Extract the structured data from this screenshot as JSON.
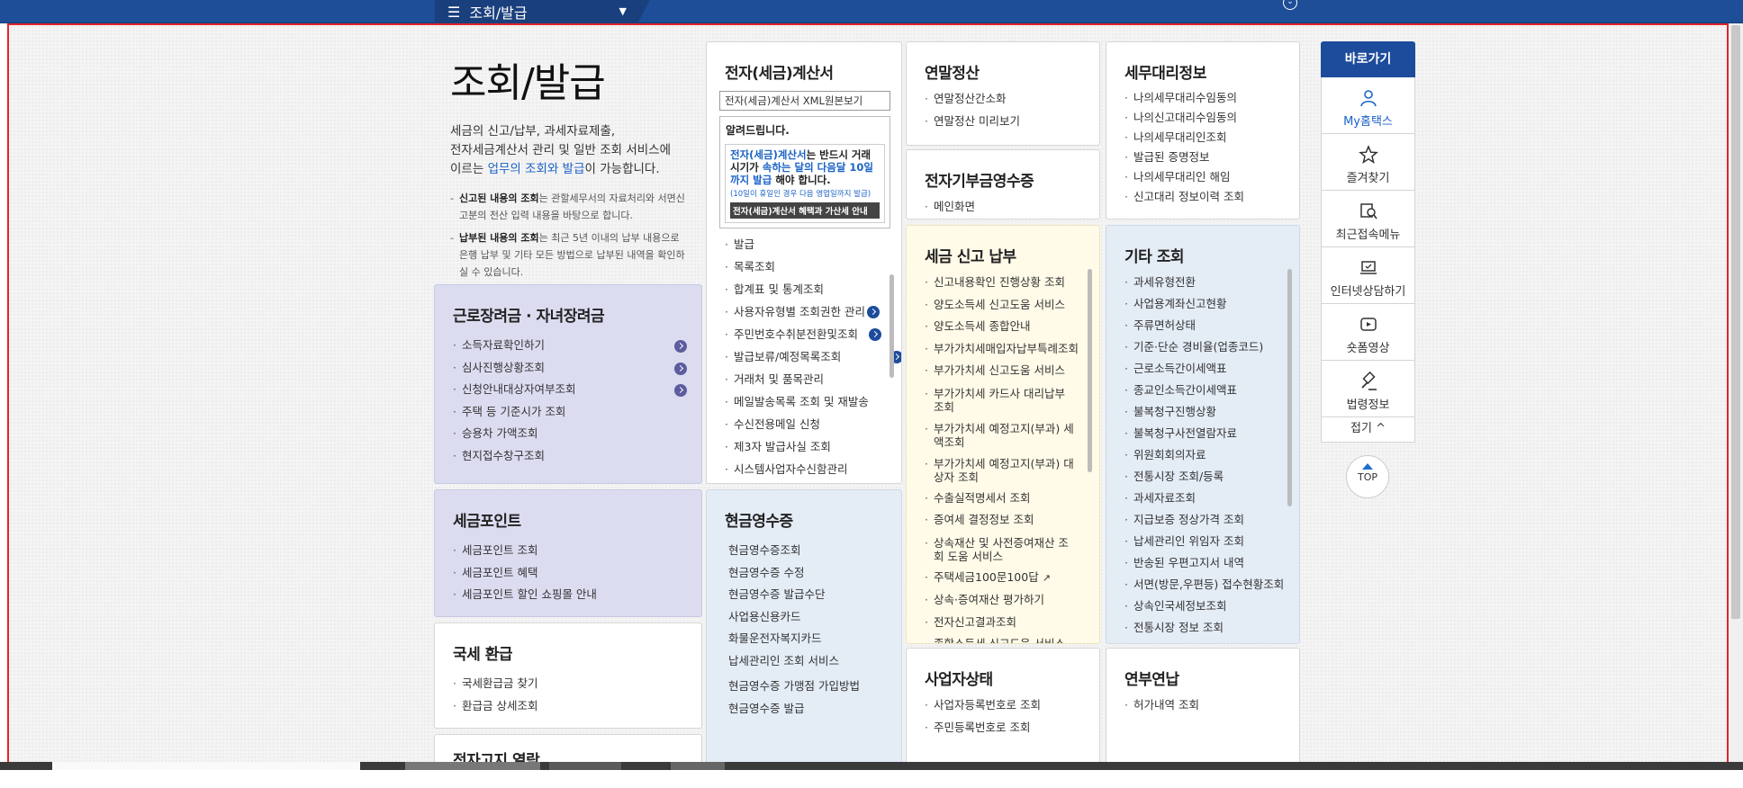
{
  "topbar": {
    "menu_label": "조회/발급"
  },
  "intro": {
    "title": "조회/발급",
    "desc_line1": "세금의 신고/납부, 과세자료제출,",
    "desc_line2": "전자세금계산서 관리 및 일반 조회 서비스에",
    "desc_pre": "이르는 ",
    "desc_highlight": "업무의 조회와 발급",
    "desc_post": "이 가능합니다.",
    "note1_bold": "신고된 내용의 조회",
    "note1_text": "는 관할세무서의 자료처리와 서면신고분의 전산 입력 내용을 바탕으로 합니다.",
    "note2_bold": "납부된 내용의 조회",
    "note2_text": "는 최근 5년 이내의 납부 내용으로 은행 납부 및 기타 모든 방법으로 납부된 내역을 확인하실 수 있습니다."
  },
  "cards": {
    "earned": {
      "title": "근로장려금 · 자녀장려금",
      "items": [
        "소득자료확인하기",
        "심사진행상황조회",
        "신청안내대상자여부조회",
        "주택 등 기준시가 조회",
        "승용차 가액조회",
        "현지접수창구조회"
      ]
    },
    "point": {
      "title": "세금포인트",
      "items": [
        "세금포인트 조회",
        "세금포인트 혜택",
        "세금포인트 할인 쇼핑몰 안내"
      ]
    },
    "refund": {
      "title": "국세 환급",
      "items": [
        "국세환급금 찾기",
        "환급금 상세조회"
      ]
    },
    "notice": {
      "title": "전자고지 열람"
    },
    "etax": {
      "title": "전자(세금)계산서",
      "xml_button": "전자(세금)계산서 XML원본보기",
      "notice_title": "알려드립니다.",
      "notice_l1_a": "전자(세금)계산서",
      "notice_l1_b": "는 반드시 거래시기가 ",
      "notice_l1_c": "속하는 달의 다음달 10일까지 발급",
      "notice_l1_d": " 해야 합니다.",
      "notice_l2": "(10일이 휴일인 경우 다음 영업일까지 발급)",
      "notice_l3": "전자(세금)계산서 혜택과 가산세 안내",
      "items": [
        "발급",
        "목록조회",
        "합계표 및 통계조회",
        "사용자유형별 조회권한 관리",
        "주민번호수취분전환및조회",
        "발급보류/예정목록조회",
        "거래처 및 품목관리",
        "메일발송목록 조회 및 재발송",
        "수신전용메일 신청",
        "제3자 발급사실 조회",
        "시스템사업자수신함관리"
      ]
    },
    "cash": {
      "title": "현금영수증",
      "items": [
        "현금영수증조회",
        "현금영수증 수정",
        "현금영수증 발급수단",
        "사업용신용카드",
        "화물운전자복지카드",
        "납세관리인 조회 서비스",
        "현금영수증 가맹점 가입방법",
        "현금영수증 발급"
      ]
    },
    "yearend": {
      "title": "연말정산",
      "items": [
        "연말정산간소화",
        "연말정산 미리보기"
      ]
    },
    "donation": {
      "title": "전자기부금영수증",
      "items": [
        "메인화면"
      ]
    },
    "report": {
      "title": "세금 신고 납부",
      "items": [
        "신고내용확인 진행상황 조회",
        "양도소득세 신고도움 서비스",
        "양도소득세 종합안내",
        "부가가치세매입자납부특례조회",
        "부가가치세 신고도움 서비스",
        "부가가치세 카드사 대리납부 조회",
        "부가가치세 예정고지(부과) 세액조회",
        "부가가치세 예정고지(부과) 대상자 조회",
        "수출실적명세서 조회",
        "증여세 결정정보 조회",
        "상속재산 및 사전증여재산 조회 도움 서비스",
        "주택세금100문100답",
        "상속·증여재산 평가하기",
        "전자신고결과조회",
        "종합소득세 신고도움 서비스"
      ]
    },
    "business": {
      "title": "사업자상태",
      "items": [
        "사업자등록번호로 조회",
        "주민등록번호로 조회"
      ]
    },
    "agent": {
      "title": "세무대리정보",
      "items": [
        "나의세무대리수임동의",
        "나의신고대리수임동의",
        "나의세무대리인조회",
        "발급된 증명정보",
        "나의세무대리인 해임",
        "신고대리 정보이력 조회"
      ]
    },
    "etc": {
      "title": "기타 조회",
      "items": [
        "과세유형전환",
        "사업용계좌신고현황",
        "주류면허상태",
        "기준·단순 경비율(업종코드)",
        "근로소득간이세액표",
        "종교인소득간이세액표",
        "불복청구진행상황",
        "불복청구사전열람자료",
        "위원회회의자료",
        "전통시장 조회/등록",
        "과세자료조회",
        "지급보증 정상가격 조회",
        "납세관리인 위임자 조회",
        "반송된 우편고지서 내역",
        "서면(방문,우편등) 접수현황조회",
        "상속인국세정보조회",
        "전통시장 정보 조회"
      ]
    },
    "pension": {
      "title": "연부연납",
      "items": [
        "허가내역 조회"
      ]
    }
  },
  "quick": {
    "head": "바로가기",
    "items": [
      "My홈택스",
      "즐겨찾기",
      "최근접속메뉴",
      "인터넷상담하기",
      "숏폼영상",
      "법령정보"
    ],
    "fold": "접기 ^",
    "top": "TOP"
  },
  "colors": {
    "brand": "#1d4c9c",
    "topbar": "#1e4e97",
    "highlight": "#1b63c6"
  }
}
